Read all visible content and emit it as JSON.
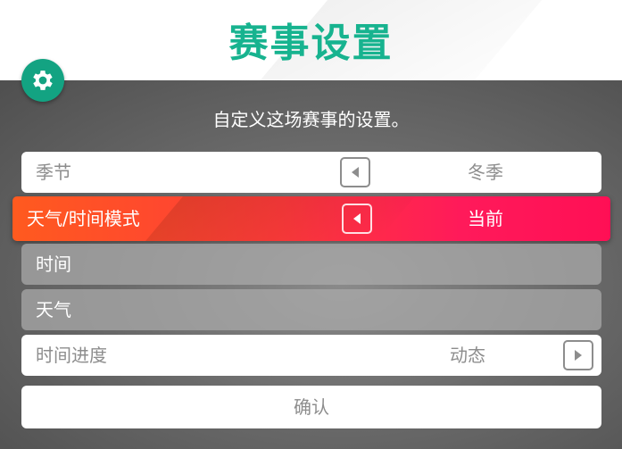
{
  "header": {
    "title": "赛事设置"
  },
  "settings_icon": "gear-icon",
  "subtitle": "自定义这场赛事的设置。",
  "rows": [
    {
      "label": "季节",
      "value": "冬季",
      "arrow": "left"
    },
    {
      "label": "天气/时间模式",
      "value": "当前",
      "arrow": "left",
      "selected": true
    },
    {
      "label": "时间",
      "value": "",
      "disabled": true
    },
    {
      "label": "天气",
      "value": "",
      "disabled": true
    },
    {
      "label": "时间进度",
      "value": "动态",
      "arrow": "right"
    }
  ],
  "confirm_label": "确认",
  "colors": {
    "accent_green": "#17b38f",
    "gear_green": "#13a382",
    "active_start": "#ff5a1f",
    "active_end": "#ff0f55",
    "text_gray": "#8d8d8d"
  }
}
